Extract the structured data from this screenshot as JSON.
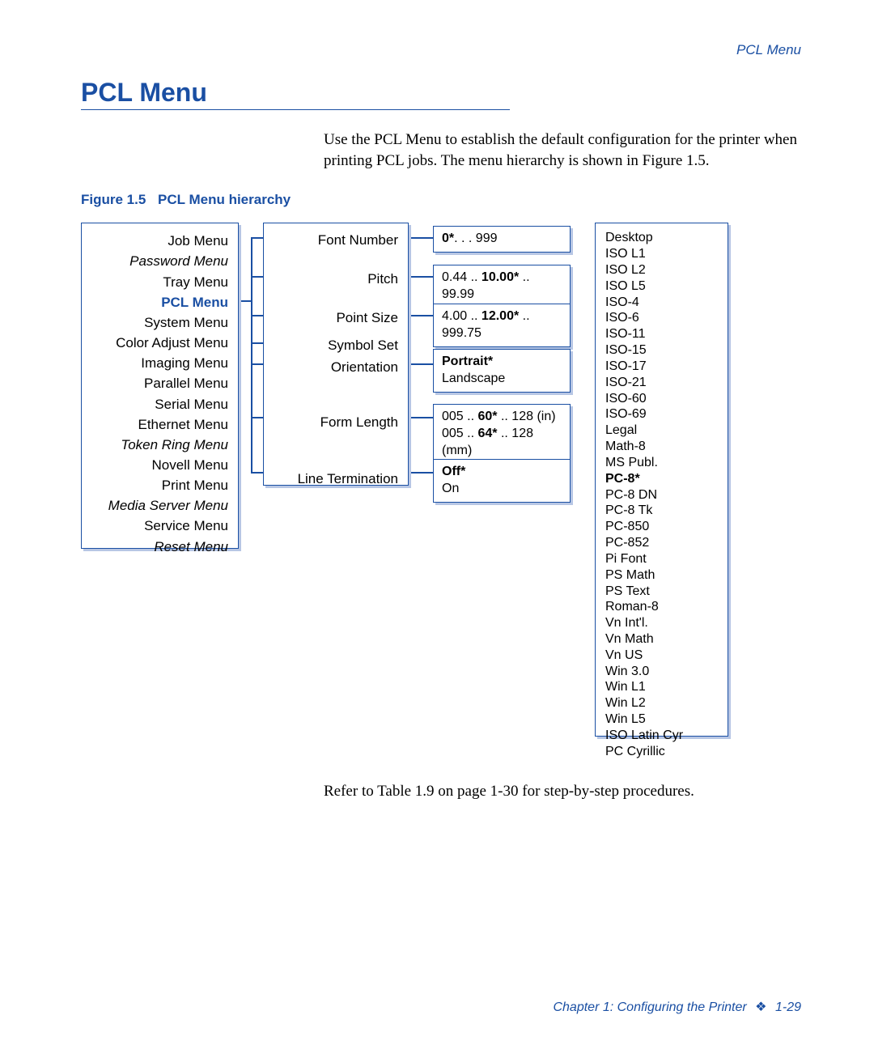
{
  "header_right": "PCL Menu",
  "title": "PCL Menu",
  "intro": "Use the PCL Menu to establish the default configuration for the printer when printing PCL jobs. The menu hierarchy is shown in Figure 1.5.",
  "figure": {
    "label": "Figure 1.5",
    "caption": "PCL Menu hierarchy"
  },
  "menu_items": [
    {
      "text": "Job Menu",
      "style": ""
    },
    {
      "text": "Password Menu",
      "style": "italic"
    },
    {
      "text": "Tray Menu",
      "style": ""
    },
    {
      "text": "PCL Menu",
      "style": "active"
    },
    {
      "text": "System Menu",
      "style": ""
    },
    {
      "text": "Color Adjust Menu",
      "style": ""
    },
    {
      "text": "Imaging Menu",
      "style": ""
    },
    {
      "text": "Parallel Menu",
      "style": ""
    },
    {
      "text": "Serial Menu",
      "style": ""
    },
    {
      "text": "Ethernet Menu",
      "style": ""
    },
    {
      "text": "Token Ring Menu",
      "style": "italic"
    },
    {
      "text": "Novell Menu",
      "style": ""
    },
    {
      "text": "Print Menu",
      "style": ""
    },
    {
      "text": "Media Server Menu",
      "style": "italic"
    },
    {
      "text": "Service Menu",
      "style": ""
    },
    {
      "text": "Reset Menu",
      "style": "italic"
    }
  ],
  "settings": {
    "font_number": "Font Number",
    "pitch": "Pitch",
    "point_size": "Point Size",
    "symbol_set": "Symbol Set",
    "orientation": "Orientation",
    "form_length": "Form Length",
    "line_termination": "Line Termination"
  },
  "values": {
    "font_number": {
      "pre": "0*",
      "rest": ". . . 999"
    },
    "pitch": {
      "pre": "0.44 .. ",
      "bold": "10.00*",
      "post": " .. 99.99"
    },
    "point_size": {
      "pre": "4.00 .. ",
      "bold": "12.00*",
      "post": " .. 999.75"
    },
    "orientation": {
      "l1_bold": "Portrait*",
      "l2": "Landscape"
    },
    "form_length": {
      "l1_pre": "005 .. ",
      "l1_bold": "60*",
      "l1_post": " .. 128 (in)",
      "l2_pre": "005 .. ",
      "l2_bold": "64*",
      "l2_post": " .. 128 (mm)"
    },
    "line_term": {
      "l1_bold": "Off*",
      "l2": "On"
    }
  },
  "symbol_sets": [
    "Desktop",
    "ISO L1",
    "ISO L2",
    "ISO L5",
    "ISO-4",
    "ISO-6",
    "ISO-11",
    "ISO-15",
    "ISO-17",
    "ISO-21",
    "ISO-60",
    "ISO-69",
    "Legal",
    "Math-8",
    "MS Publ.",
    "PC-8*",
    "PC-8 DN",
    "PC-8 Tk",
    "PC-850",
    "PC-852",
    "Pi Font",
    "PS Math",
    "PS Text",
    "Roman-8",
    "Vn Int'l.",
    "Vn Math",
    "Vn US",
    "Win 3.0",
    "Win L1",
    "Win L2",
    "Win L5",
    "ISO Latin Cyr",
    "PC Cyrillic"
  ],
  "symbol_bold_index": 15,
  "after_text": "Refer to Table 1.9 on page 1-30 for step-by-step procedures.",
  "footer": {
    "chapter": "Chapter 1: Configuring the Printer",
    "page": "1-29"
  }
}
